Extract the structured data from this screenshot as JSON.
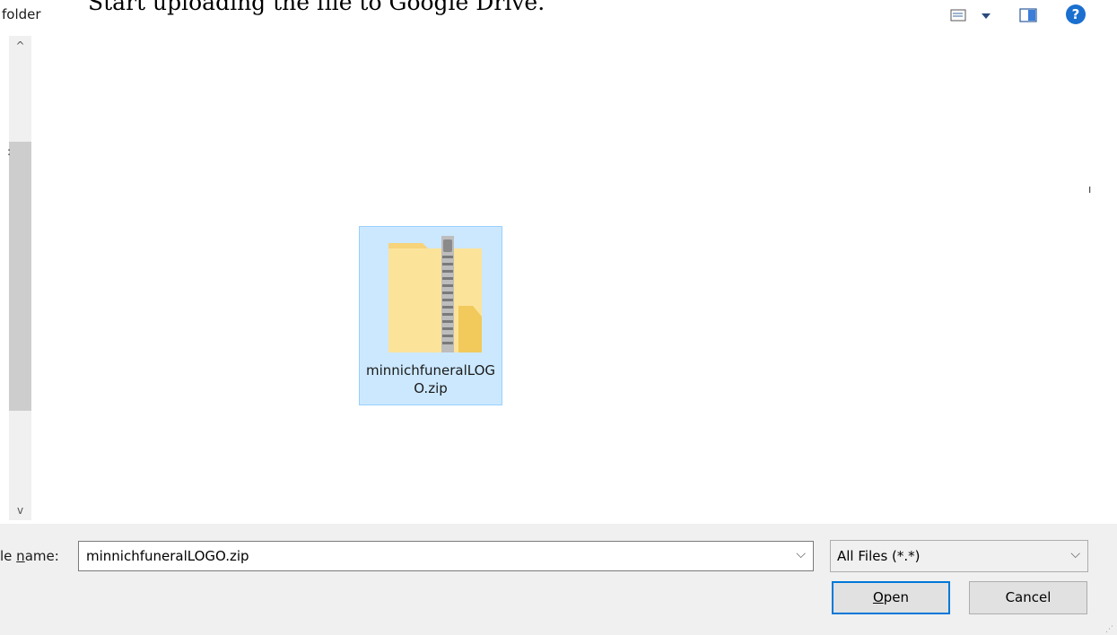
{
  "overlay": {
    "text": "Start uploading the file to Google Drive."
  },
  "toolbar": {
    "folder_label": "folder",
    "help_label": "?"
  },
  "scrollbar": {
    "up": "^",
    "down": "v"
  },
  "files": [
    {
      "name": "minnichfuneralLOGO.zip",
      "icon": "zip-folder-icon",
      "selected": true
    }
  ],
  "file_name_row": {
    "label_prefix": "le ",
    "label_underlined": "n",
    "label_suffix": "ame:",
    "value": "minnichfuneralLOGO.zip",
    "chevron": "⌵"
  },
  "file_type": {
    "value": "All Files (*.*)",
    "chevron": "⌵"
  },
  "buttons": {
    "open_underlined": "O",
    "open_rest": "pen",
    "cancel": "Cancel"
  },
  "colors": {
    "selection_bg": "#cce8ff",
    "selection_border": "#99d1ff",
    "accent": "#0078d7",
    "dialog_bg": "#f0f0f0"
  }
}
